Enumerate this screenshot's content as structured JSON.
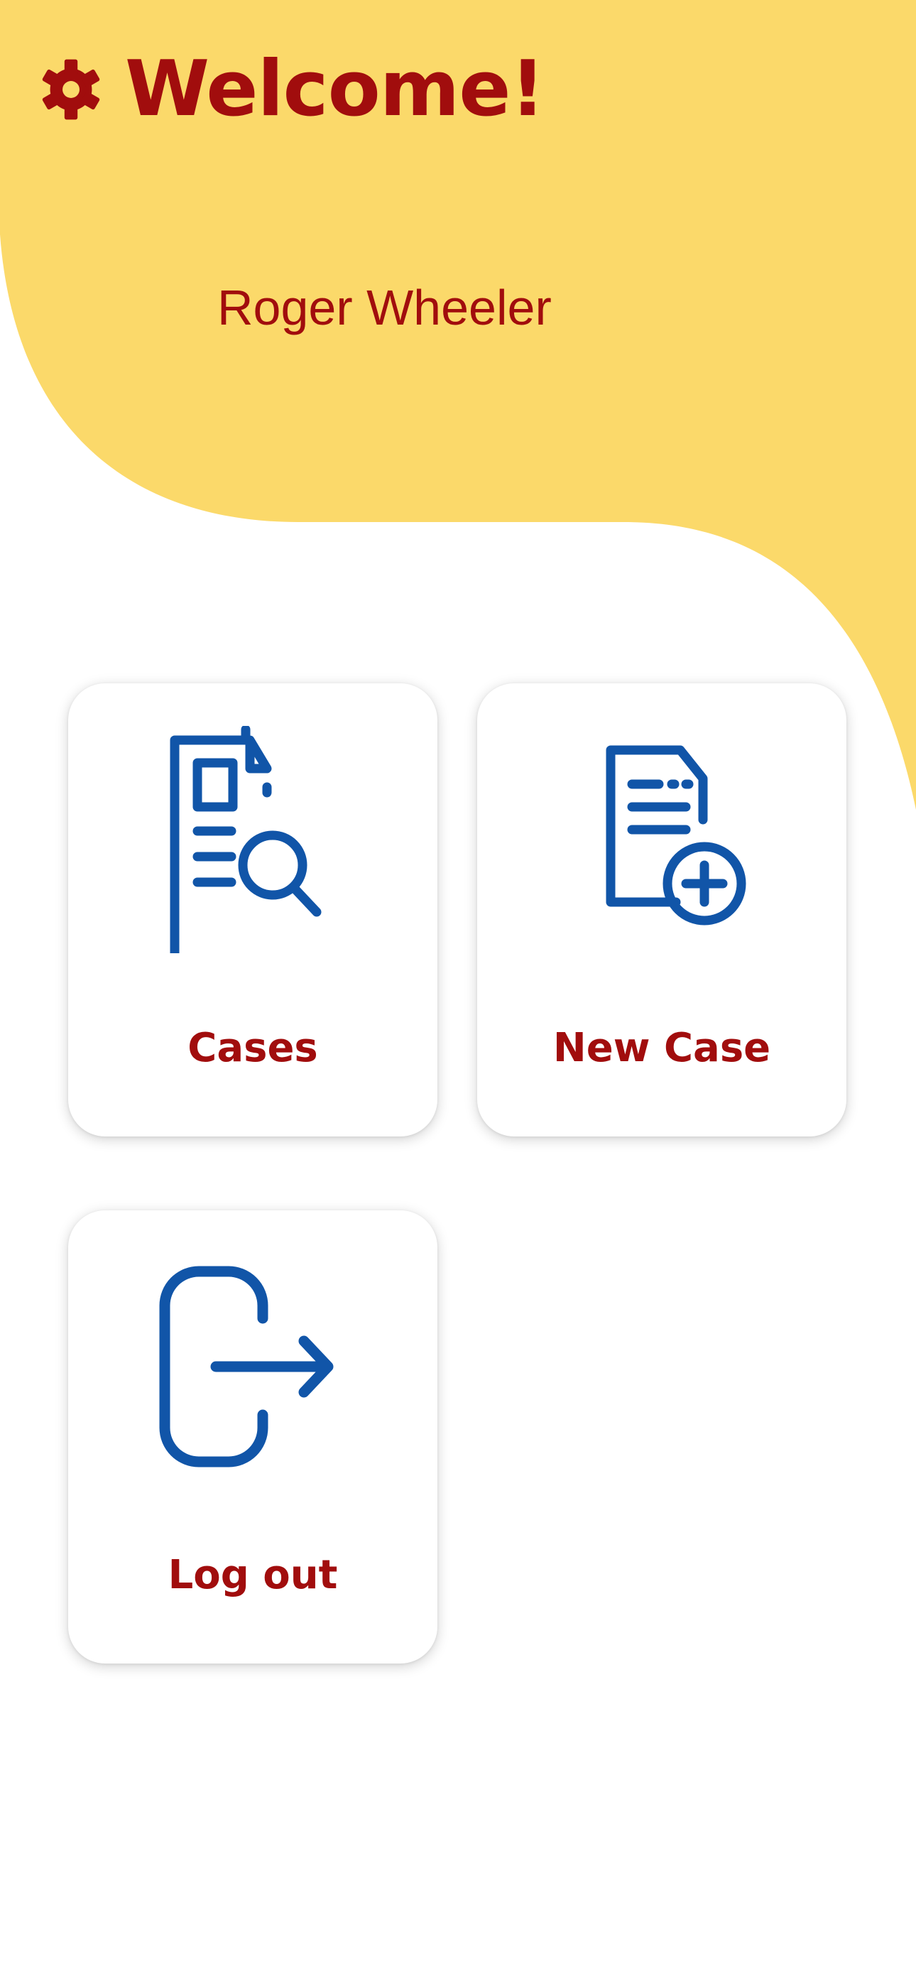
{
  "header": {
    "title": "Welcome!",
    "settings_icon": "gear-icon",
    "user_name": "Roger Wheeler"
  },
  "tiles": [
    {
      "label": "Cases",
      "icon": "document-search-icon"
    },
    {
      "label": "New Case",
      "icon": "document-add-icon"
    },
    {
      "label": "Log out",
      "icon": "logout-icon"
    }
  ],
  "colors": {
    "accent_yellow": "#fbd96a",
    "text_red": "#a10d0d",
    "icon_blue": "#1155a8",
    "background": "#ffffff"
  }
}
